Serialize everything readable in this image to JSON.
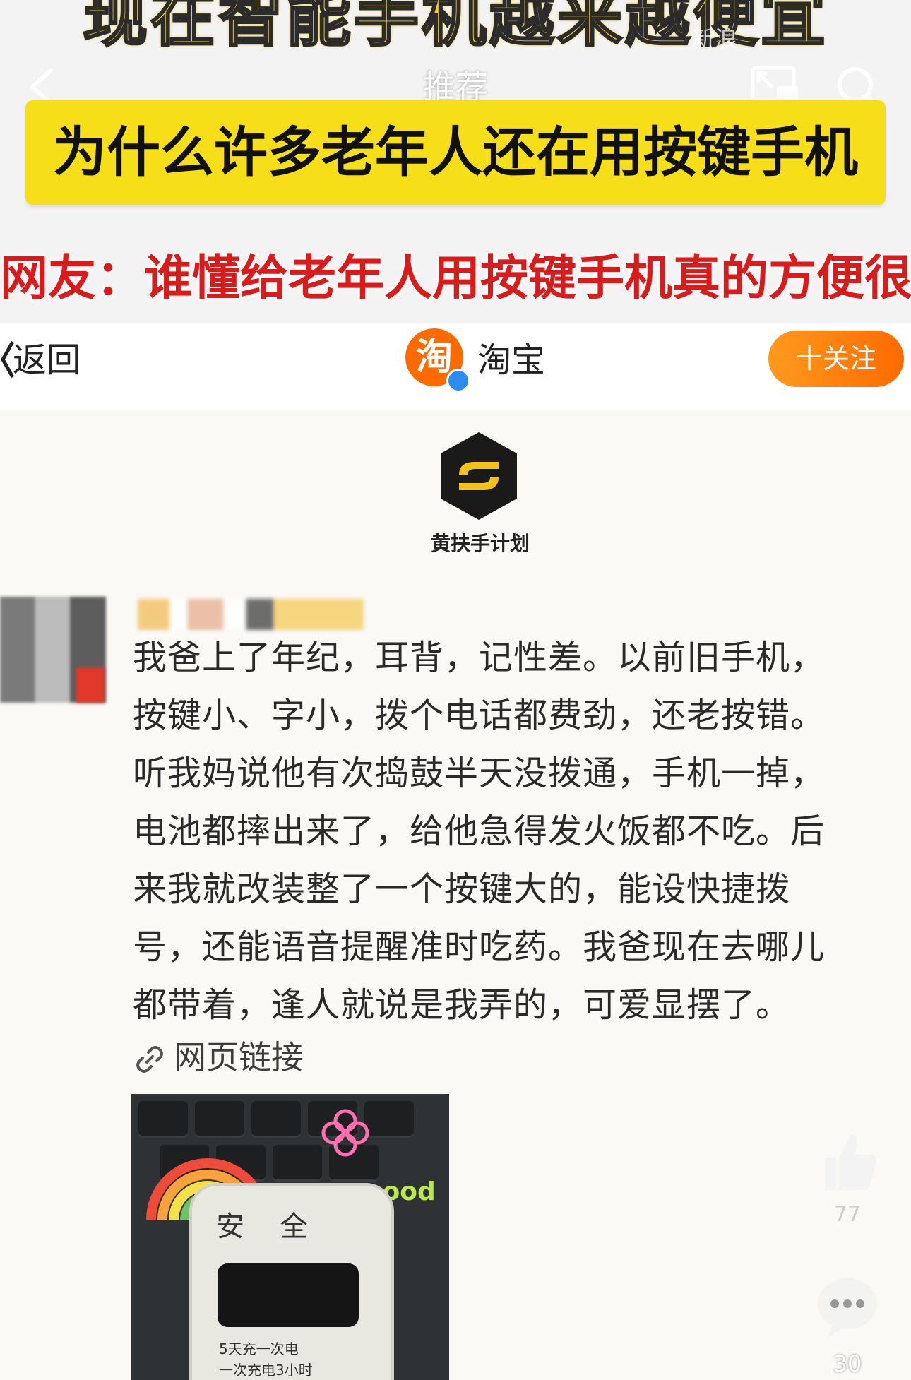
{
  "video_overlay": {
    "top_headline": "现在智能手机越来越便宜",
    "tab_title": "推荐",
    "watermark": "新浪",
    "yellow_title": "为什么许多老年人还在用按键手机",
    "red_subtitle": "网友：谁懂给老年人用按键手机真的方便很多"
  },
  "app_bar": {
    "back_label": "返回",
    "account_logo_char": "淘",
    "account_name": "淘宝",
    "follow_label": "十关注"
  },
  "program": {
    "name": "黄扶手计划"
  },
  "comment": {
    "lines": [
      "我爸上了年纪，耳背，记性差。以前旧手机，",
      "按键小、字小，拨个电话都费劲，还老按错。",
      "听我妈说他有次捣鼓半天没拨通，手机一掉，",
      "电池都摔出来了，给他急得发火饭都不吃。后",
      "来我就改装整了一个按键大的，能设快捷拨",
      "号，还能语音提醒准时吃药。我爸现在去哪儿",
      "都带着，逢人就说是我弄的，可爱显摆了。"
    ],
    "link_label": "网页链接",
    "photo": {
      "phone_label_top": "安全",
      "note_lines": [
        "5天充一次电",
        "一次充电3小时"
      ],
      "sticker_text": "mood"
    }
  },
  "actions": {
    "like_count": "77",
    "comment_count": "30"
  },
  "colors": {
    "banner_yellow": "#f6df19",
    "subtitle_red": "#d81b1b",
    "taobao_orange": "#ff6a00"
  }
}
